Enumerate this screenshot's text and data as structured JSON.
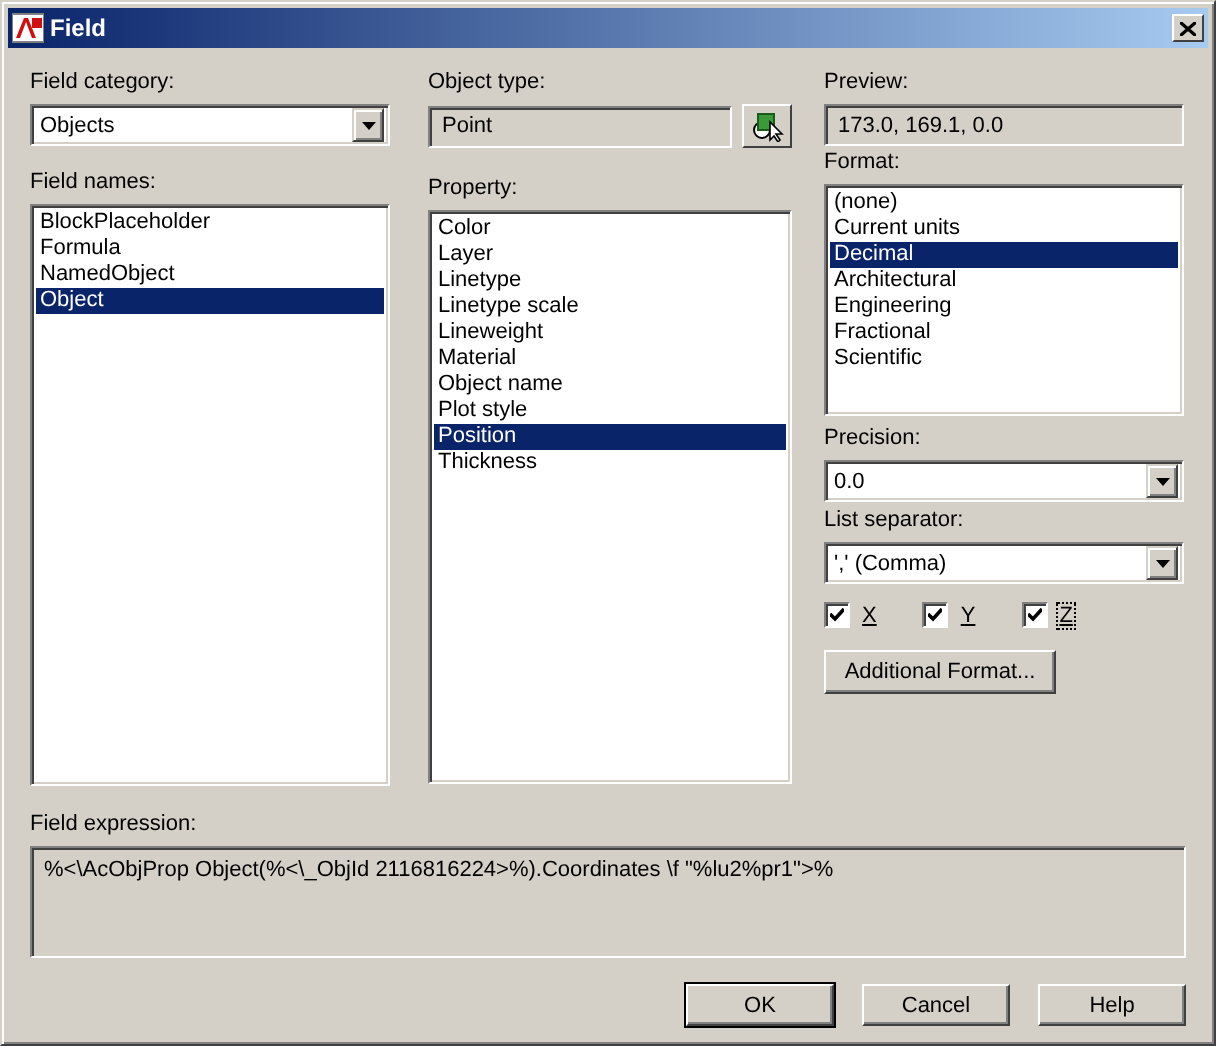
{
  "window": {
    "title": "Field"
  },
  "field_category": {
    "label": "Field category:",
    "value": "Objects"
  },
  "field_names": {
    "label": "Field names:",
    "items": [
      {
        "label": "BlockPlaceholder",
        "selected": false
      },
      {
        "label": "Formula",
        "selected": false
      },
      {
        "label": "NamedObject",
        "selected": false
      },
      {
        "label": "Object",
        "selected": true
      }
    ]
  },
  "object_type": {
    "label": "Object type:",
    "value": "Point"
  },
  "property": {
    "label": "Property:",
    "items": [
      {
        "label": "Color",
        "selected": false
      },
      {
        "label": "Layer",
        "selected": false
      },
      {
        "label": "Linetype",
        "selected": false
      },
      {
        "label": "Linetype scale",
        "selected": false
      },
      {
        "label": "Lineweight",
        "selected": false
      },
      {
        "label": "Material",
        "selected": false
      },
      {
        "label": "Object name",
        "selected": false
      },
      {
        "label": "Plot style",
        "selected": false
      },
      {
        "label": "Position",
        "selected": true
      },
      {
        "label": "Thickness",
        "selected": false
      }
    ]
  },
  "preview": {
    "label": "Preview:",
    "value": "173.0, 169.1, 0.0"
  },
  "format": {
    "label": "Format:",
    "items": [
      {
        "label": "(none)",
        "selected": false
      },
      {
        "label": "Current units",
        "selected": false
      },
      {
        "label": "Decimal",
        "selected": true
      },
      {
        "label": "Architectural",
        "selected": false
      },
      {
        "label": "Engineering",
        "selected": false
      },
      {
        "label": "Fractional",
        "selected": false
      },
      {
        "label": "Scientific",
        "selected": false
      }
    ]
  },
  "precision": {
    "label": "Precision:",
    "value": "0.0"
  },
  "list_separator": {
    "label": "List separator:",
    "value": "',' (Comma)"
  },
  "checkboxes": [
    {
      "label": "X",
      "checked": true,
      "focused": false
    },
    {
      "label": "Y",
      "checked": true,
      "focused": false
    },
    {
      "label": "Z",
      "checked": true,
      "focused": true
    }
  ],
  "additional_format_button": "Additional Format...",
  "field_expression": {
    "label": "Field expression:",
    "value": "%<\\AcObjProp Object(%<\\_ObjId 2116816224>%).Coordinates \\f \"%lu2%pr1\">%"
  },
  "buttons": [
    {
      "label": "OK",
      "default": true
    },
    {
      "label": "Cancel",
      "default": false
    },
    {
      "label": "Help",
      "default": false
    }
  ]
}
